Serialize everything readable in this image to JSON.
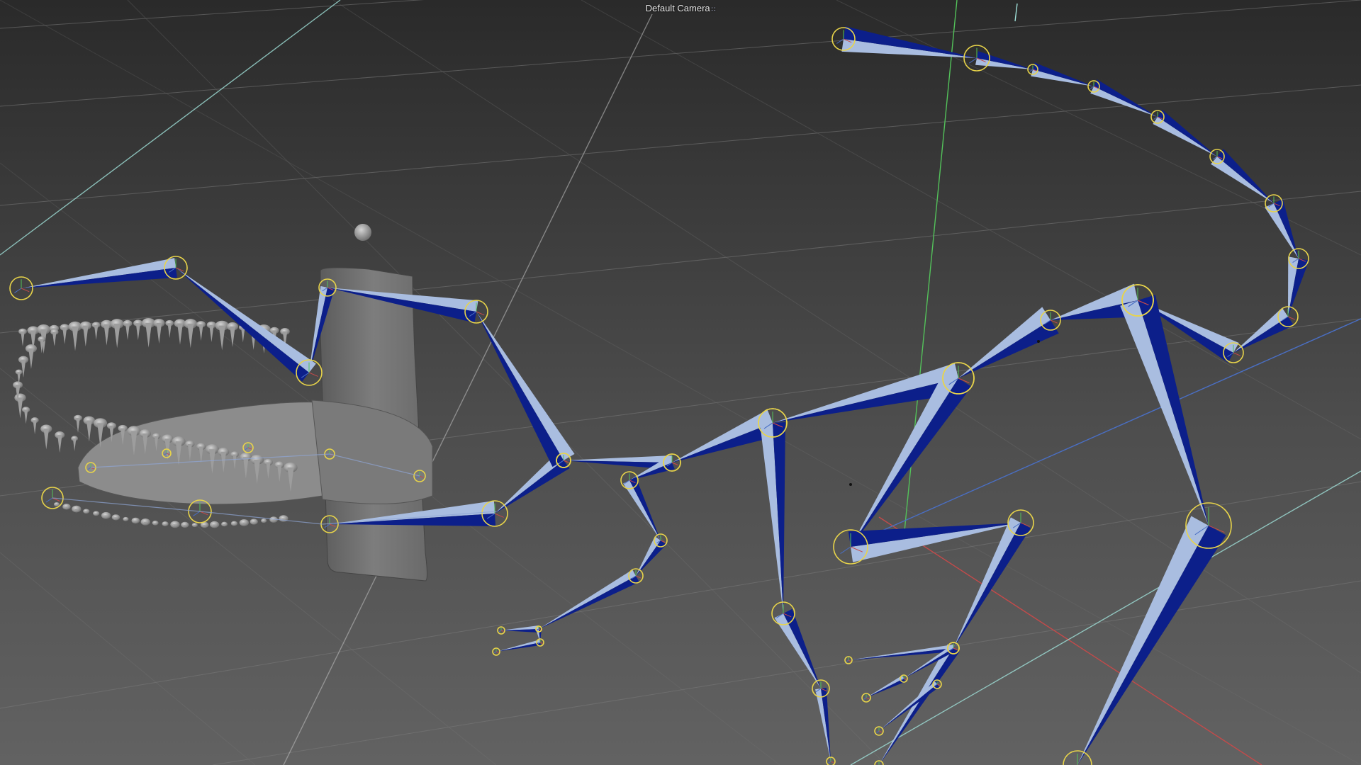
{
  "viewport": {
    "camera_label": "Default Camera",
    "camera_icon": "camera-options-icon",
    "colors": {
      "background_top": "#2b2b2b",
      "background_bottom": "#5f5f5f",
      "grid_line": "#7a7a7a",
      "axis_y": "#53c25a",
      "axis_x": "#c44a4a",
      "axis_z": "#4a6fc4",
      "joint_ring": "#e8d44a",
      "bone_dark": "#0c1f8a",
      "bone_light": "#a9bde0",
      "mesh": "#8a8a8a"
    }
  }
}
